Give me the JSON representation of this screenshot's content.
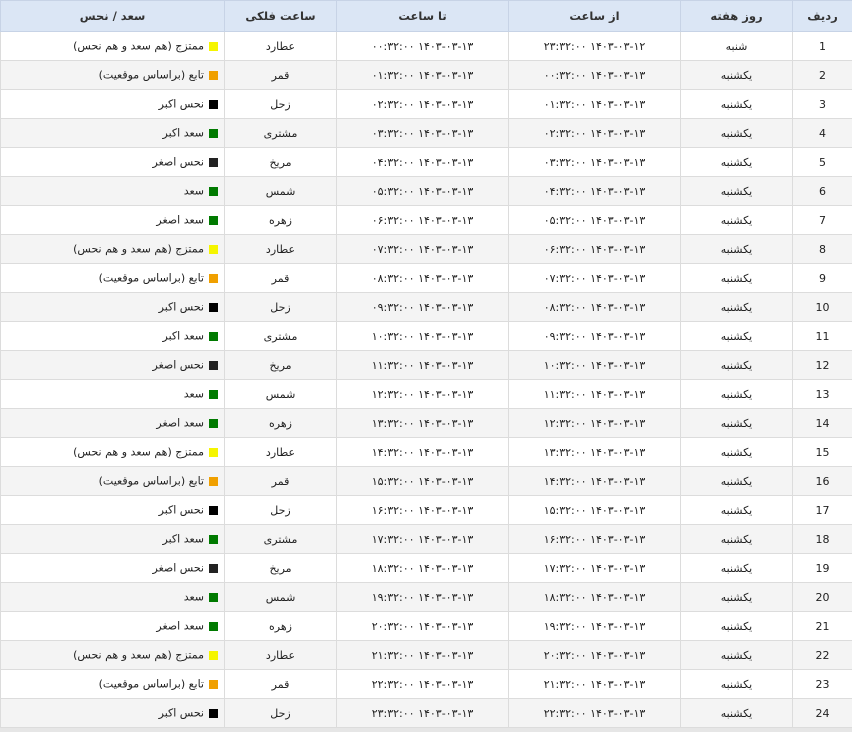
{
  "table": {
    "headers": {
      "row": "ردیف",
      "weekday": "روز هفته",
      "from": "از ساعت",
      "to": "تا ساعت",
      "planet": "ساعت فلکی",
      "status": "سعد / نحس"
    },
    "rows": [
      {
        "row": "1",
        "weekday": "شنبه",
        "from": "۱۴۰۳-۰۳-۱۲ ۲۳:۳۲:۰۰",
        "to": "۱۴۰۳-۰۳-۱۳ ۰۰:۳۲:۰۰",
        "planet": "عطارد",
        "status": "ممتزج (هم سعد و هم نحس)",
        "color": "#f5f500"
      },
      {
        "row": "2",
        "weekday": "یکشنبه",
        "from": "۱۴۰۳-۰۳-۱۳ ۰۰:۳۲:۰۰",
        "to": "۱۴۰۳-۰۳-۱۳ ۰۱:۳۲:۰۰",
        "planet": "قمر",
        "status": "تابع (براساس موقعیت)",
        "color": "#f0a000"
      },
      {
        "row": "3",
        "weekday": "یکشنبه",
        "from": "۱۴۰۳-۰۳-۱۳ ۰۱:۳۲:۰۰",
        "to": "۱۴۰۳-۰۳-۱۳ ۰۲:۳۲:۰۰",
        "planet": "زحل",
        "status": "نحس اکبر",
        "color": "#000000"
      },
      {
        "row": "4",
        "weekday": "یکشنبه",
        "from": "۱۴۰۳-۰۳-۱۳ ۰۲:۳۲:۰۰",
        "to": "۱۴۰۳-۰۳-۱۳ ۰۳:۳۲:۰۰",
        "planet": "مشتری",
        "status": "سعد اکبر",
        "color": "#007a00"
      },
      {
        "row": "5",
        "weekday": "یکشنبه",
        "from": "۱۴۰۳-۰۳-۱۳ ۰۳:۳۲:۰۰",
        "to": "۱۴۰۳-۰۳-۱۳ ۰۴:۳۲:۰۰",
        "planet": "مریخ",
        "status": "نحس اصغر",
        "color": "#222222"
      },
      {
        "row": "6",
        "weekday": "یکشنبه",
        "from": "۱۴۰۳-۰۳-۱۳ ۰۴:۳۲:۰۰",
        "to": "۱۴۰۳-۰۳-۱۳ ۰۵:۳۲:۰۰",
        "planet": "شمس",
        "status": "سعد",
        "color": "#007a00"
      },
      {
        "row": "7",
        "weekday": "یکشنبه",
        "from": "۱۴۰۳-۰۳-۱۳ ۰۵:۳۲:۰۰",
        "to": "۱۴۰۳-۰۳-۱۳ ۰۶:۳۲:۰۰",
        "planet": "زهره",
        "status": "سعد اصغر",
        "color": "#007a00"
      },
      {
        "row": "8",
        "weekday": "یکشنبه",
        "from": "۱۴۰۳-۰۳-۱۳ ۰۶:۳۲:۰۰",
        "to": "۱۴۰۳-۰۳-۱۳ ۰۷:۳۲:۰۰",
        "planet": "عطارد",
        "status": "ممتزج (هم سعد و هم نحس)",
        "color": "#f5f500"
      },
      {
        "row": "9",
        "weekday": "یکشنبه",
        "from": "۱۴۰۳-۰۳-۱۳ ۰۷:۳۲:۰۰",
        "to": "۱۴۰۳-۰۳-۱۳ ۰۸:۳۲:۰۰",
        "planet": "قمر",
        "status": "تابع (براساس موقعیت)",
        "color": "#f0a000"
      },
      {
        "row": "10",
        "weekday": "یکشنبه",
        "from": "۱۴۰۳-۰۳-۱۳ ۰۸:۳۲:۰۰",
        "to": "۱۴۰۳-۰۳-۱۳ ۰۹:۳۲:۰۰",
        "planet": "زحل",
        "status": "نحس اکبر",
        "color": "#000000"
      },
      {
        "row": "11",
        "weekday": "یکشنبه",
        "from": "۱۴۰۳-۰۳-۱۳ ۰۹:۳۲:۰۰",
        "to": "۱۴۰۳-۰۳-۱۳ ۱۰:۳۲:۰۰",
        "planet": "مشتری",
        "status": "سعد اکبر",
        "color": "#007a00"
      },
      {
        "row": "12",
        "weekday": "یکشنبه",
        "from": "۱۴۰۳-۰۳-۱۳ ۱۰:۳۲:۰۰",
        "to": "۱۴۰۳-۰۳-۱۳ ۱۱:۳۲:۰۰",
        "planet": "مریخ",
        "status": "نحس اصغر",
        "color": "#222222"
      },
      {
        "row": "13",
        "weekday": "یکشنبه",
        "from": "۱۴۰۳-۰۳-۱۳ ۱۱:۳۲:۰۰",
        "to": "۱۴۰۳-۰۳-۱۳ ۱۲:۳۲:۰۰",
        "planet": "شمس",
        "status": "سعد",
        "color": "#007a00"
      },
      {
        "row": "14",
        "weekday": "یکشنبه",
        "from": "۱۴۰۳-۰۳-۱۳ ۱۲:۳۲:۰۰",
        "to": "۱۴۰۳-۰۳-۱۳ ۱۳:۳۲:۰۰",
        "planet": "زهره",
        "status": "سعد اصغر",
        "color": "#007a00"
      },
      {
        "row": "15",
        "weekday": "یکشنبه",
        "from": "۱۴۰۳-۰۳-۱۳ ۱۳:۳۲:۰۰",
        "to": "۱۴۰۳-۰۳-۱۳ ۱۴:۳۲:۰۰",
        "planet": "عطارد",
        "status": "ممتزج (هم سعد و هم نحس)",
        "color": "#f5f500"
      },
      {
        "row": "16",
        "weekday": "یکشنبه",
        "from": "۱۴۰۳-۰۳-۱۳ ۱۴:۳۲:۰۰",
        "to": "۱۴۰۳-۰۳-۱۳ ۱۵:۳۲:۰۰",
        "planet": "قمر",
        "status": "تابع (براساس موقعیت)",
        "color": "#f0a000"
      },
      {
        "row": "17",
        "weekday": "یکشنبه",
        "from": "۱۴۰۳-۰۳-۱۳ ۱۵:۳۲:۰۰",
        "to": "۱۴۰۳-۰۳-۱۳ ۱۶:۳۲:۰۰",
        "planet": "زحل",
        "status": "نحس اکبر",
        "color": "#000000"
      },
      {
        "row": "18",
        "weekday": "یکشنبه",
        "from": "۱۴۰۳-۰۳-۱۳ ۱۶:۳۲:۰۰",
        "to": "۱۴۰۳-۰۳-۱۳ ۱۷:۳۲:۰۰",
        "planet": "مشتری",
        "status": "سعد اکبر",
        "color": "#007a00"
      },
      {
        "row": "19",
        "weekday": "یکشنبه",
        "from": "۱۴۰۳-۰۳-۱۳ ۱۷:۳۲:۰۰",
        "to": "۱۴۰۳-۰۳-۱۳ ۱۸:۳۲:۰۰",
        "planet": "مریخ",
        "status": "نحس اصغر",
        "color": "#222222"
      },
      {
        "row": "20",
        "weekday": "یکشنبه",
        "from": "۱۴۰۳-۰۳-۱۳ ۱۸:۳۲:۰۰",
        "to": "۱۴۰۳-۰۳-۱۳ ۱۹:۳۲:۰۰",
        "planet": "شمس",
        "status": "سعد",
        "color": "#007a00"
      },
      {
        "row": "21",
        "weekday": "یکشنبه",
        "from": "۱۴۰۳-۰۳-۱۳ ۱۹:۳۲:۰۰",
        "to": "۱۴۰۳-۰۳-۱۳ ۲۰:۳۲:۰۰",
        "planet": "زهره",
        "status": "سعد اصغر",
        "color": "#007a00"
      },
      {
        "row": "22",
        "weekday": "یکشنبه",
        "from": "۱۴۰۳-۰۳-۱۳ ۲۰:۳۲:۰۰",
        "to": "۱۴۰۳-۰۳-۱۳ ۲۱:۳۲:۰۰",
        "planet": "عطارد",
        "status": "ممتزج (هم سعد و هم نحس)",
        "color": "#f5f500"
      },
      {
        "row": "23",
        "weekday": "یکشنبه",
        "from": "۱۴۰۳-۰۳-۱۳ ۲۱:۳۲:۰۰",
        "to": "۱۴۰۳-۰۳-۱۳ ۲۲:۳۲:۰۰",
        "planet": "قمر",
        "status": "تابع (براساس موقعیت)",
        "color": "#f0a000"
      },
      {
        "row": "24",
        "weekday": "یکشنبه",
        "from": "۱۴۰۳-۰۳-۱۳ ۲۲:۳۲:۰۰",
        "to": "۱۴۰۳-۰۳-۱۳ ۲۳:۳۲:۰۰",
        "planet": "زحل",
        "status": "نحس اکبر",
        "color": "#000000"
      }
    ]
  }
}
